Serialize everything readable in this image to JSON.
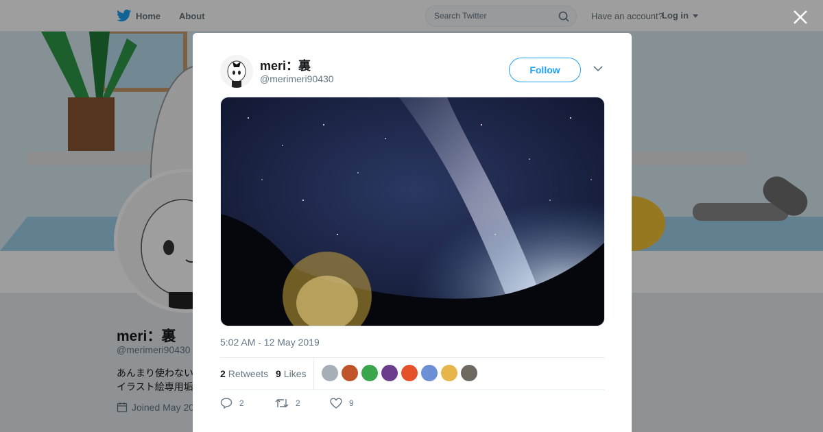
{
  "nav": {
    "home_label": "Home",
    "about_label": "About",
    "search_placeholder": "Search Twitter",
    "have_account": "Have an account?",
    "login_label": "Log in"
  },
  "profile": {
    "name": "meri：裏",
    "handle": "@merimeri90430",
    "bio_line1": "あんまり使わない",
    "bio_line2": "イラスト絵専用垢",
    "joined": "Joined May 20"
  },
  "tweet": {
    "author_name": "meri：裏",
    "author_handle": "@merimeri90430",
    "follow_label": "Follow",
    "timestamp": "5:02 AM - 12 May 2019",
    "retweets_count": "2",
    "retweets_label": "Retweets",
    "likes_count": "9",
    "likes_label": "Likes",
    "reply_count": "2",
    "retweet_action_count": "2",
    "like_action_count": "9"
  },
  "colors": {
    "brand": "#1da1f2",
    "muted": "#657786"
  },
  "icons": [
    "twitter-bird-icon",
    "search-icon",
    "caret-down-icon",
    "close-icon",
    "chevron-down-icon",
    "reply-icon",
    "retweet-icon",
    "like-icon",
    "calendar-icon"
  ]
}
